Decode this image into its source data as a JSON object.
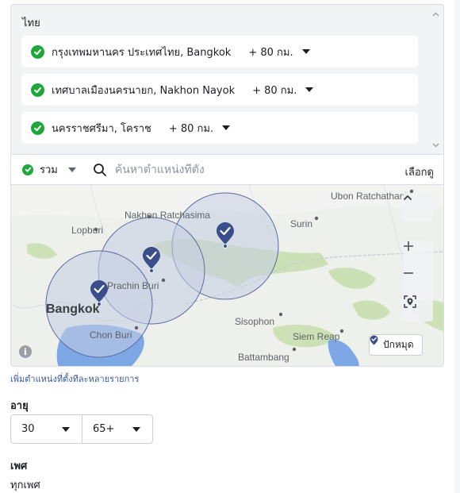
{
  "locations": {
    "country": "ไทย",
    "items": [
      {
        "name": "กรุงเทพมหานคร ประเทศไทย, Bangkok",
        "radius": "+ 80 กม."
      },
      {
        "name": "เทศบาลเมืองนครนายก, Nakhon Nayok",
        "radius": "+ 80 กม."
      },
      {
        "name": "นครราชศรีมา, โคราช",
        "radius": "+ 80 กม."
      }
    ]
  },
  "search": {
    "include_label": "รวม",
    "placeholder": "ค้นหาตำแหน่งที่ตั้ง",
    "browse_label": "เลือกดู"
  },
  "map": {
    "places": {
      "ubon": "Ubon Ratchathani",
      "nakhon_ratchasima": "Nakhon Ratchasima",
      "lopburi": "Lopburi",
      "surin": "Surin",
      "prachin_buri": "Prachin Buri",
      "bangkok": "Bangkok",
      "sisophon": "Sisophon",
      "chon_buri": "Chon Buri",
      "siem_reap": "Siem Reap",
      "battambang": "Battambang"
    },
    "drop_pin_label": "ปักหมุด",
    "icons": [
      "chevron-up-icon",
      "zoom-in-icon",
      "zoom-out-icon",
      "locate-icon",
      "info-icon",
      "pin-icon"
    ],
    "colors": {
      "radius_fill": "#c5cde3",
      "radius_stroke": "#5b6aa0",
      "pin": "#3b4e8c",
      "water": "#7ea7e6"
    }
  },
  "add_bulk_label": "เพิ่มตำแหน่งที่ตั้งทีละหลายรายการ",
  "age": {
    "heading": "อายุ",
    "min": "30",
    "max": "65+"
  },
  "gender": {
    "heading": "เพศ",
    "value": "ทุกเพศ"
  },
  "colors": {
    "check_green": "#1ea83c",
    "link_blue": "#385898"
  }
}
